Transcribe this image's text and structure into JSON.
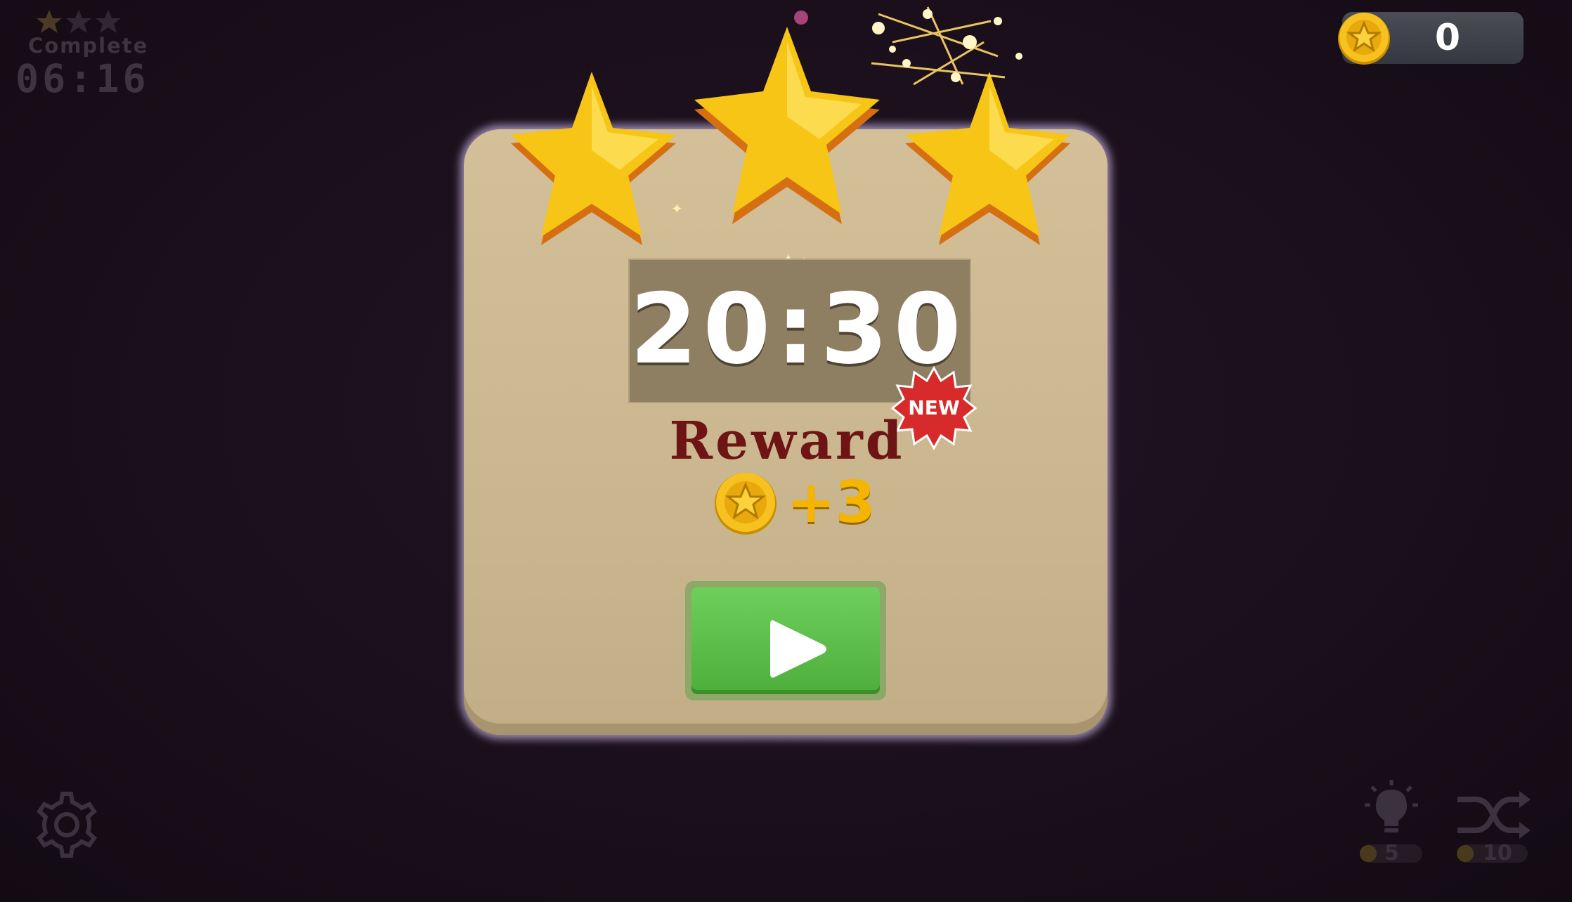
{
  "hud": {
    "complete_label": "Complete",
    "elapsed_time": "06:16",
    "stars_earned": 1,
    "stars_total": 3,
    "coin_balance": "0"
  },
  "dialog": {
    "stars_earned": 3,
    "time": "20:30",
    "new_badge": "NEW",
    "reward_label": "Reward",
    "reward_amount": "+3"
  },
  "tools": {
    "hint_cost": "5",
    "shuffle_cost": "10"
  },
  "colors": {
    "panel": "#cfbb94",
    "reward_text": "#6e1414",
    "coin_gold": "#f5b400",
    "play_green": "#5bbd47",
    "new_badge_red": "#d72a2a"
  },
  "icons": {
    "coin": "star-coin-icon",
    "play": "play-icon",
    "settings": "gear-icon",
    "hint": "lightbulb-icon",
    "shuffle": "shuffle-icon"
  }
}
